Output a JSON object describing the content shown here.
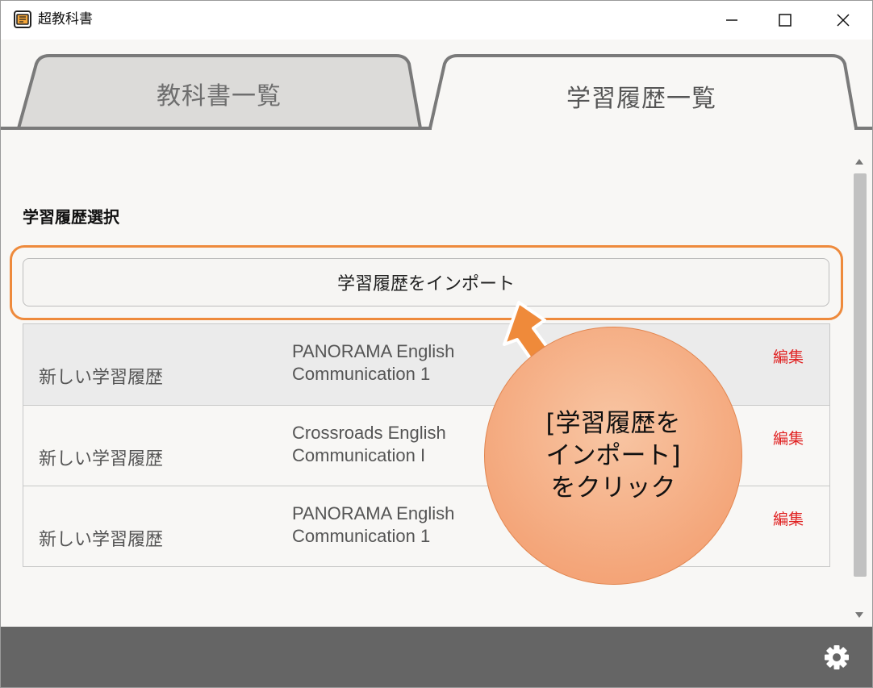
{
  "window": {
    "title": "超教科書",
    "icon": "app-logo-icon"
  },
  "tabs": [
    {
      "label": "教科書一覧",
      "active": false
    },
    {
      "label": "学習履歴一覧",
      "active": true
    }
  ],
  "section": {
    "title": "学習履歴選択"
  },
  "import_button": {
    "label": "学習履歴をインポート"
  },
  "history": [
    {
      "name": "新しい学習履歴",
      "book_line1": "PANORAMA English",
      "book_line2": "Communication 1",
      "edit_label": "編集"
    },
    {
      "name": "新しい学習履歴",
      "book_line1": "Crossroads English",
      "book_line2": "Communication I",
      "edit_label": "編集"
    },
    {
      "name": "新しい学習履歴",
      "book_line1": "PANORAMA English",
      "book_line2": "Communication 1",
      "edit_label": "編集"
    }
  ],
  "callout": {
    "line1": "[学習履歴を",
    "line2": "インポート]",
    "line3": "をクリック"
  },
  "colors": {
    "highlight": "#ee8a3c",
    "edit": "#e02020",
    "footer": "#656565"
  },
  "footer": {
    "settings_icon": "gear-icon"
  }
}
